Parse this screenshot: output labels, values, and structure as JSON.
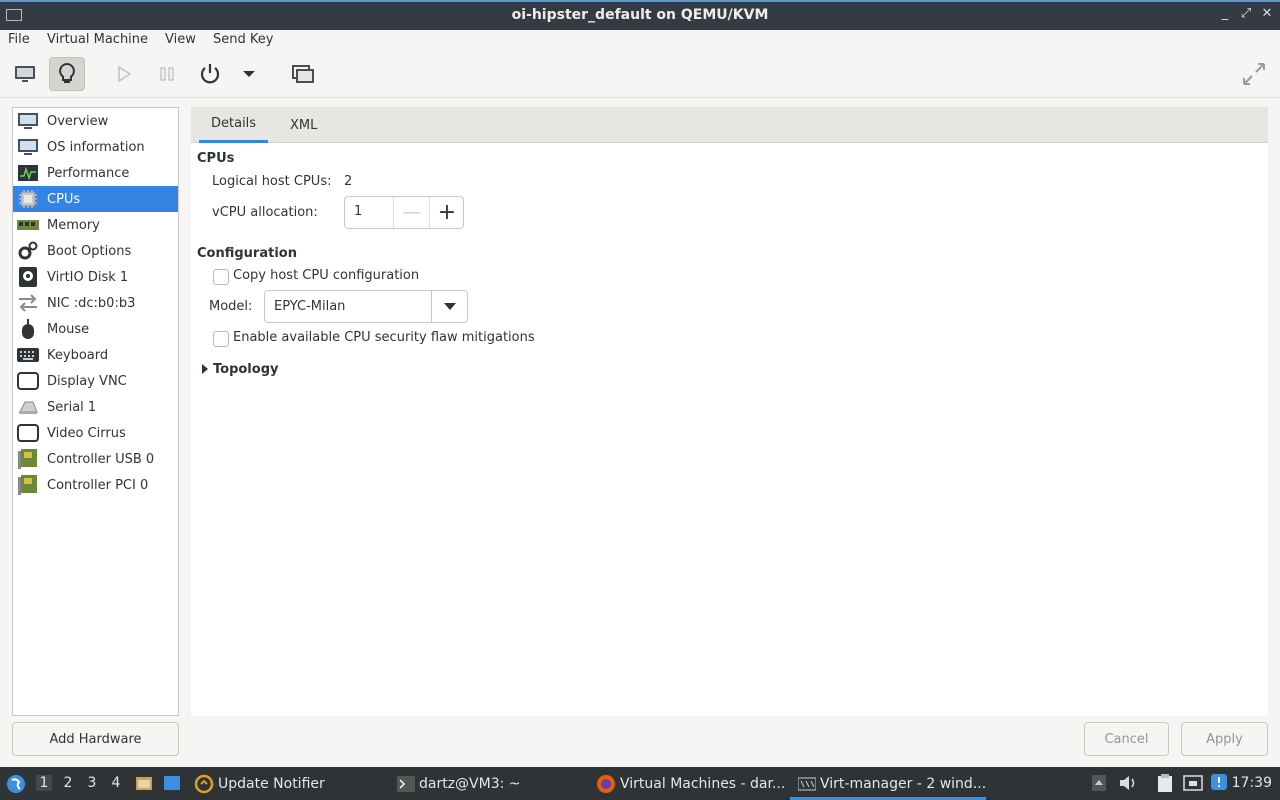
{
  "window": {
    "title": "oi-hipster_default on QEMU/KVM",
    "controls": [
      "_",
      "⤢",
      "✕"
    ]
  },
  "menubar": [
    "File",
    "Virtual Machine",
    "View",
    "Send Key"
  ],
  "toolbar": {
    "icons": [
      "monitor-icon",
      "lightbulb-icon",
      "play-icon",
      "pause-icon",
      "power-icon",
      "dropdown-arrow-icon",
      "snapshot-icon",
      "fullscreen-icon"
    ]
  },
  "sidebar": {
    "items": [
      {
        "label": "Overview",
        "icon": "monitor-icon"
      },
      {
        "label": "OS information",
        "icon": "monitor-icon"
      },
      {
        "label": "Performance",
        "icon": "performance-graph-icon"
      },
      {
        "label": "CPUs",
        "icon": "cpu-chip-icon",
        "selected": true
      },
      {
        "label": "Memory",
        "icon": "memory-stick-icon"
      },
      {
        "label": "Boot Options",
        "icon": "gears-icon"
      },
      {
        "label": "VirtIO Disk 1",
        "icon": "disk-icon"
      },
      {
        "label": "NIC :dc:b0:b3",
        "icon": "network-arrows-icon"
      },
      {
        "label": "Mouse",
        "icon": "mouse-icon"
      },
      {
        "label": "Keyboard",
        "icon": "keyboard-icon"
      },
      {
        "label": "Display VNC",
        "icon": "display-icon"
      },
      {
        "label": "Serial 1",
        "icon": "serial-port-icon"
      },
      {
        "label": "Video Cirrus",
        "icon": "display-icon"
      },
      {
        "label": "Controller USB 0",
        "icon": "controller-card-icon"
      },
      {
        "label": "Controller PCI 0",
        "icon": "controller-card-icon"
      }
    ],
    "add_hardware": "Add Hardware"
  },
  "tabs": [
    "Details",
    "XML"
  ],
  "cpus": {
    "section_title": "CPUs",
    "logical_label": "Logical host CPUs:",
    "logical_value": "2",
    "vcpu_label": "vCPU allocation:",
    "vcpu_value": "1",
    "minus": "—",
    "plus": "+"
  },
  "configuration": {
    "section_title": "Configuration",
    "copy_host_label": "Copy host CPU configuration",
    "copy_host_checked": false,
    "model_label": "Model:",
    "model_value": "EPYC-Milan",
    "mitigations_label": "Enable available CPU security flaw mitigations",
    "mitigations_checked": false
  },
  "topology": {
    "label": "Topology",
    "expanded": false
  },
  "buttons": {
    "cancel": "Cancel",
    "apply": "Apply"
  },
  "taskbar": {
    "workspaces": [
      "1",
      "2",
      "3",
      "4"
    ],
    "active_workspace": "1",
    "tasks": [
      {
        "label": "Update Notifier",
        "icon": "update-notifier-icon"
      },
      {
        "label": "dartz@VM3: ~",
        "icon": "terminal-icon"
      },
      {
        "label": "Virtual Machines - dar...",
        "icon": "firefox-icon"
      },
      {
        "label": "Virt-manager - 2 wind...",
        "icon": "virt-manager-icon",
        "active": true
      }
    ],
    "clock": "17:39"
  },
  "colors": {
    "accent": "#3584e4",
    "titlebar": "#353b42",
    "taskbar": "#2e3336"
  }
}
